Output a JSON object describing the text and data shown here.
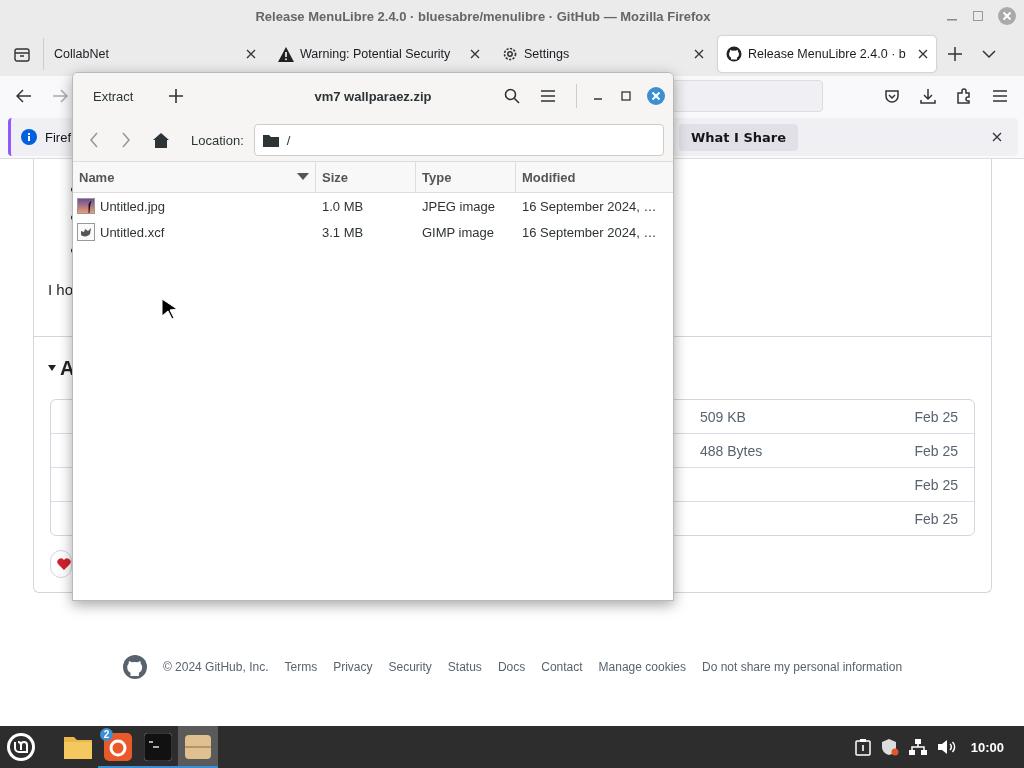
{
  "window": {
    "title": "Release MenuLibre 2.4.0 · bluesabre/menulibre · GitHub — Mozilla Firefox"
  },
  "tabs": [
    {
      "label": "CollabNet",
      "kind": "plain",
      "selected": false
    },
    {
      "label": "Warning: Potential Security",
      "kind": "warning",
      "selected": false
    },
    {
      "label": "Settings",
      "kind": "settings",
      "selected": false
    },
    {
      "label": "Release MenuLibre 2.4.0 · b",
      "kind": "github",
      "selected": true
    }
  ],
  "notification": {
    "text": "Firef",
    "button": "What I Share"
  },
  "page": {
    "paragraph": "I ho",
    "section_heading": "A",
    "assets": [
      {
        "size": "509 KB",
        "date": "Feb 25"
      },
      {
        "size": "488 Bytes",
        "date": "Feb 25"
      },
      {
        "date": "Feb 25"
      },
      {
        "date": "Feb 25"
      }
    ]
  },
  "footer": {
    "copyright": "© 2024 GitHub, Inc.",
    "links": [
      "Terms",
      "Privacy",
      "Security",
      "Status",
      "Docs",
      "Contact",
      "Manage cookies",
      "Do not share my personal information"
    ]
  },
  "archive": {
    "extract_button": "Extract",
    "title": "vm7 wallparaez.zip",
    "location_label": "Location:",
    "location": "/",
    "columns": [
      "Name",
      "Size",
      "Type",
      "Modified"
    ],
    "files": [
      {
        "name": "Untitled.jpg",
        "kind": "photo",
        "size": "1.0 MB",
        "type": "JPEG image",
        "modified": "16 September 2024, …"
      },
      {
        "name": "Untitled.xcf",
        "kind": "gimp",
        "size": "3.1 MB",
        "type": "GIMP image",
        "modified": "16 September 2024, …"
      }
    ]
  },
  "taskbar": {
    "apps": [
      {
        "kind": "files",
        "running": false,
        "active": false
      },
      {
        "kind": "firefox",
        "running": true,
        "active": false,
        "badge": "2"
      },
      {
        "kind": "terminal",
        "running": true,
        "active": false
      },
      {
        "kind": "archive",
        "running": true,
        "active": true
      }
    ],
    "clock": "10:00"
  }
}
